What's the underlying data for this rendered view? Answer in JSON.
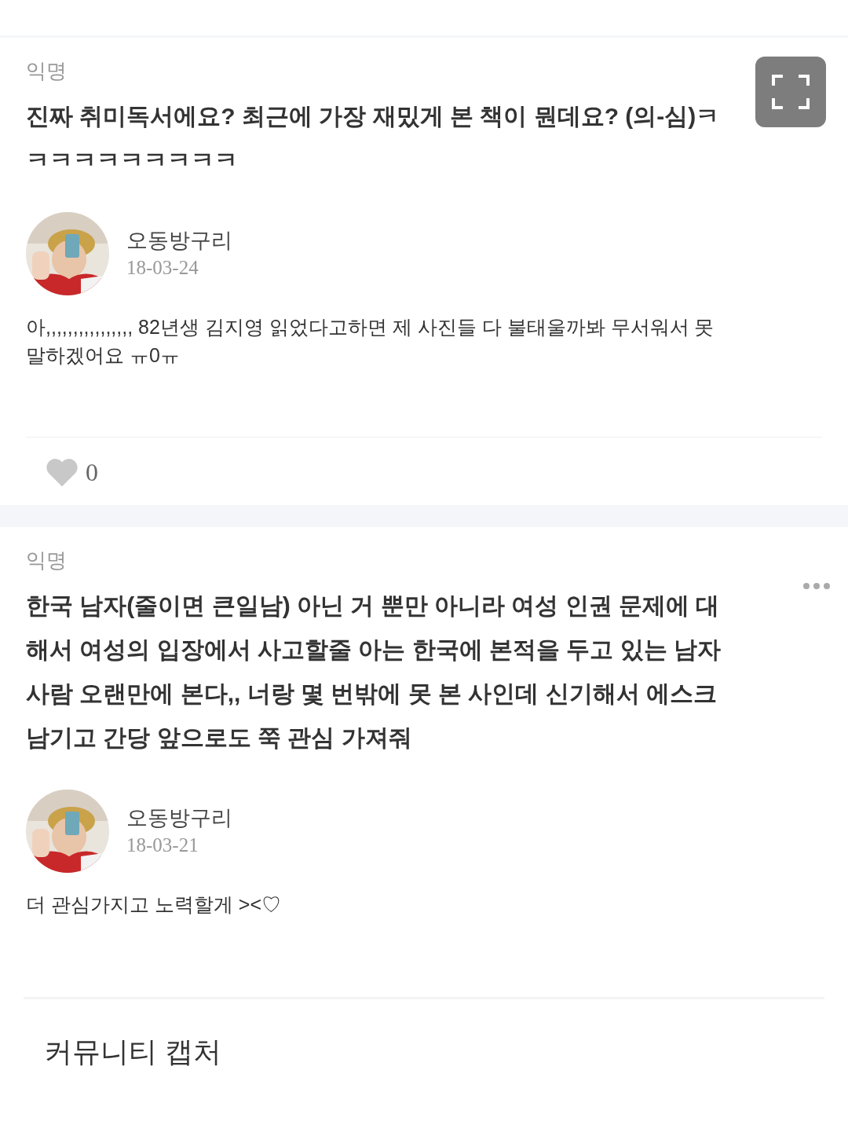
{
  "posts": [
    {
      "author_label": "익명",
      "question": "진짜 취미독서에요? 최근에 가장 재밌게 본 책이 뭔데요? (의-심)ㅋㅋㅋㅋㅋㅋㅋㅋㅋㅋ",
      "reply": {
        "name": "오동방구리",
        "date": "18-03-24",
        "text": "아,,,,,,,,,,,,,,,, 82년생 김지영 읽었다고하면 제 사진들 다 불태울까봐 무서워서 못말하겠어요 ㅠ0ㅠ"
      },
      "likes": "0",
      "liked": false
    },
    {
      "author_label": "익명",
      "question": "한국 남자(줄이면 큰일남) 아닌 거 뿐만 아니라 여성 인권 문제에 대해서 여성의 입장에서 사고할줄 아는 한국에 본적을 두고 있는 남자 사람 오랜만에 본다,, 너랑 몇 번밖에 못 본 사인데 신기해서 에스크 남기고 간당 앞으로도 쭉 관심 가져줘",
      "reply": {
        "name": "오동방구리",
        "date": "18-03-21",
        "text": "더 관심가지고 노력할게 ><♡"
      }
    }
  ],
  "caption": "커뮤니티 캡처"
}
